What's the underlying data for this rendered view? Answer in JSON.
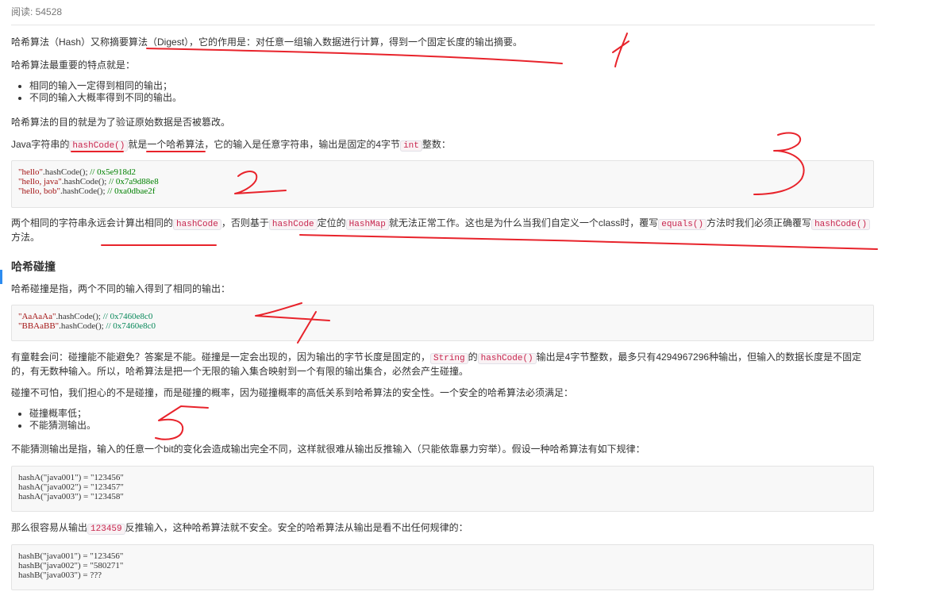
{
  "header": {
    "reads": "阅读: 54528"
  },
  "p1": {
    "pre": "哈希算法（Hash）又称摘要算法（Digest），它的作用是：对任意一组输入数据进行计算，得到一个固定长度的输出摘要。"
  },
  "p2": {
    "text": "哈希算法最重要的特点就是："
  },
  "list1": [
    "相同的输入一定得到相同的输出；",
    "不同的输入大概率得到不同的输出。"
  ],
  "p3": {
    "text": "哈希算法的目的就是为了验证原始数据是否被篡改。"
  },
  "p4": {
    "t1": "Java字符串的",
    "c1": "hashCode()",
    "t2": "就是一个哈希算法，它的输入是任意字符串，输出是固定的4字节",
    "c2": "int",
    "t3": "整数："
  },
  "code1": {
    "l1s": "\"hello\"",
    "l1m": ".hashCode(); ",
    "l1c": "// 0x5e918d2",
    "l2s": "\"hello, java\"",
    "l2m": ".hashCode(); ",
    "l2c": "// 0x7a9d88e8",
    "l3s": "\"hello, bob\"",
    "l3m": ".hashCode(); ",
    "l3c": "// 0xa0dbae2f"
  },
  "p5": {
    "t1": "两个相同的字符串永远会计算出相同的",
    "c1": "hashCode",
    "t2": "，否则基于",
    "c2": "hashCode",
    "t3": "定位的",
    "c3": "HashMap",
    "t4": "就无法正常工作。这也是为什么当我们自定义一个class时，覆写",
    "c4": "equals()",
    "t5": "方法时我们必须正确覆写",
    "c5": "hashCode()",
    "t6": "方法。"
  },
  "h_collision": "哈希碰撞",
  "p6": {
    "text": "哈希碰撞是指，两个不同的输入得到了相同的输出："
  },
  "code2": {
    "l1s": "\"AaAaAa\"",
    "l1m": ".hashCode(); ",
    "l1c": "// 0x7460e8c0",
    "l2s": "\"BBAaBB\"",
    "l2m": ".hashCode(); ",
    "l2c": "// 0x7460e8c0"
  },
  "p7": {
    "t1": "有童鞋会问：碰撞能不能避免？答案是不能。碰撞是一定会出现的，因为输出的字节长度是固定的，",
    "c1": "String",
    "t2": "的",
    "c2": "hashCode()",
    "t3": "输出是4字节整数，最多只有4294967296种输出，但输入的数据长度是不固定的，有无数种输入。所以，哈希算法是把一个无限的输入集合映射到一个有限的输出集合，必然会产生碰撞。"
  },
  "p8": {
    "text": "碰撞不可怕，我们担心的不是碰撞，而是碰撞的概率，因为碰撞概率的高低关系到哈希算法的安全性。一个安全的哈希算法必须满足："
  },
  "list2": [
    "碰撞概率低；",
    "不能猜测输出。"
  ],
  "p9": {
    "text": "不能猜测输出是指，输入的任意一个bit的变化会造成输出完全不同，这样就很难从输出反推输入（只能依靠暴力穷举）。假设一种哈希算法有如下规律："
  },
  "code3": {
    "l1": "hashA(\"java001\") = \"123456\"",
    "l2": "hashA(\"java002\") = \"123457\"",
    "l3": "hashA(\"java003\") = \"123458\""
  },
  "p10": {
    "t1": "那么很容易从输出",
    "c1": "123459",
    "t2": "反推输入，这种哈希算法就不安全。安全的哈希算法从输出是看不出任何规律的："
  },
  "code4": {
    "l1": "hashB(\"java001\") = \"123456\"",
    "l2": "hashB(\"java002\") = \"580271\"",
    "l3": "hashB(\"java003\") = ???"
  },
  "colors": {
    "inline_code": "#c7254e",
    "annotation": "#e8232b",
    "code_bg": "#f8f8f8"
  }
}
